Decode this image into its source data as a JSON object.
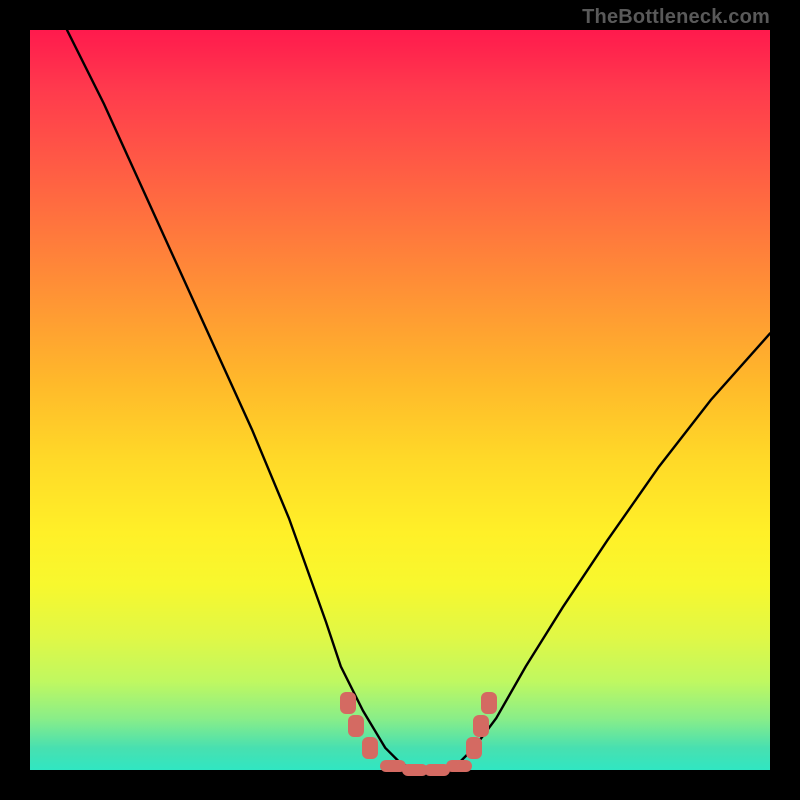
{
  "watermark": "TheBottleneck.com",
  "colors": {
    "frame": "#000000",
    "gradient_top": "#ff1a4d",
    "gradient_bottom": "#30e6c2",
    "curve": "#000000",
    "marker": "#d46a62",
    "watermark_text": "#595959"
  },
  "chart_data": {
    "type": "line",
    "title": "",
    "xlabel": "",
    "ylabel": "",
    "xlim": [
      0,
      100
    ],
    "ylim": [
      0,
      100
    ],
    "grid": false,
    "legend": false,
    "note": "V-shaped bottleneck curve; y-axis plotted with 0 at bottom. Values estimated from pixel positions — no axis ticks present.",
    "series": [
      {
        "name": "bottleneck-curve",
        "x": [
          5,
          10,
          15,
          20,
          25,
          30,
          35,
          40,
          42,
          45,
          48,
          50,
          52,
          55,
          58,
          60,
          63,
          67,
          72,
          78,
          85,
          92,
          100
        ],
        "y": [
          100,
          90,
          79,
          68,
          57,
          46,
          34,
          20,
          14,
          8,
          3,
          1,
          0,
          0,
          1,
          3,
          7,
          14,
          22,
          31,
          41,
          50,
          59
        ]
      }
    ],
    "markers": {
      "name": "highlight-band",
      "note": "Salmon rounded markers near curve bottom",
      "points": [
        {
          "x": 43,
          "y": 9
        },
        {
          "x": 44,
          "y": 6
        },
        {
          "x": 46,
          "y": 3
        },
        {
          "x": 49,
          "y": 0.5
        },
        {
          "x": 52,
          "y": 0
        },
        {
          "x": 55,
          "y": 0
        },
        {
          "x": 58,
          "y": 0.5
        },
        {
          "x": 60,
          "y": 3
        },
        {
          "x": 61,
          "y": 6
        },
        {
          "x": 62,
          "y": 9
        }
      ]
    }
  }
}
